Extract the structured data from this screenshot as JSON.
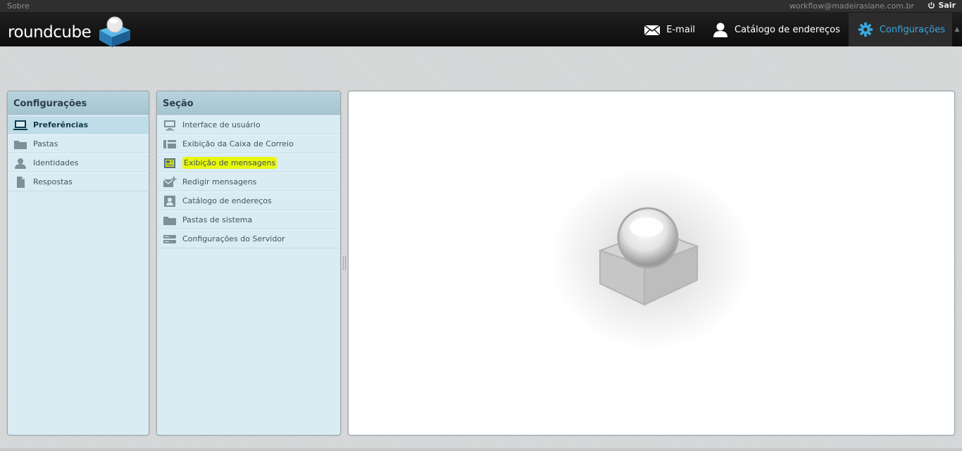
{
  "topline": {
    "about": "Sobre",
    "username": "workflow@madeiraslane.com.br",
    "logout": "Sair"
  },
  "header": {
    "logo_text": "roundcube",
    "tasks": [
      {
        "label": "E-mail",
        "icon": "envelope-icon",
        "active": false
      },
      {
        "label": "Catálogo de endereços",
        "icon": "person-icon",
        "active": false
      },
      {
        "label": "Configurações",
        "icon": "gear-icon",
        "active": true
      }
    ]
  },
  "settings_tabs": {
    "title": "Configurações",
    "items": [
      {
        "label": "Preferências",
        "icon": "monitor-icon",
        "selected": true
      },
      {
        "label": "Pastas",
        "icon": "folder-icon",
        "selected": false
      },
      {
        "label": "Identidades",
        "icon": "person-icon",
        "selected": false
      },
      {
        "label": "Respostas",
        "icon": "document-icon",
        "selected": false
      }
    ]
  },
  "sections": {
    "title": "Seção",
    "items": [
      {
        "label": "Interface de usuário",
        "icon": "monitor-icon"
      },
      {
        "label": "Exibição da Caixa de Correio",
        "icon": "layout-icon"
      },
      {
        "label": "Exibição de mensagens",
        "icon": "message-view-icon",
        "highlighted": true
      },
      {
        "label": "Redigir mensagens",
        "icon": "compose-icon"
      },
      {
        "label": "Catálogo de endereços",
        "icon": "contact-card-icon"
      },
      {
        "label": "Pastas de sistema",
        "icon": "folder-icon"
      },
      {
        "label": "Configurações do Servidor",
        "icon": "server-icon"
      }
    ]
  },
  "colors": {
    "accent": "#39a8e0",
    "panel_bg": "#d9ecf4",
    "panel_header": "#a4c4d0",
    "highlight": "#e8f80b"
  }
}
